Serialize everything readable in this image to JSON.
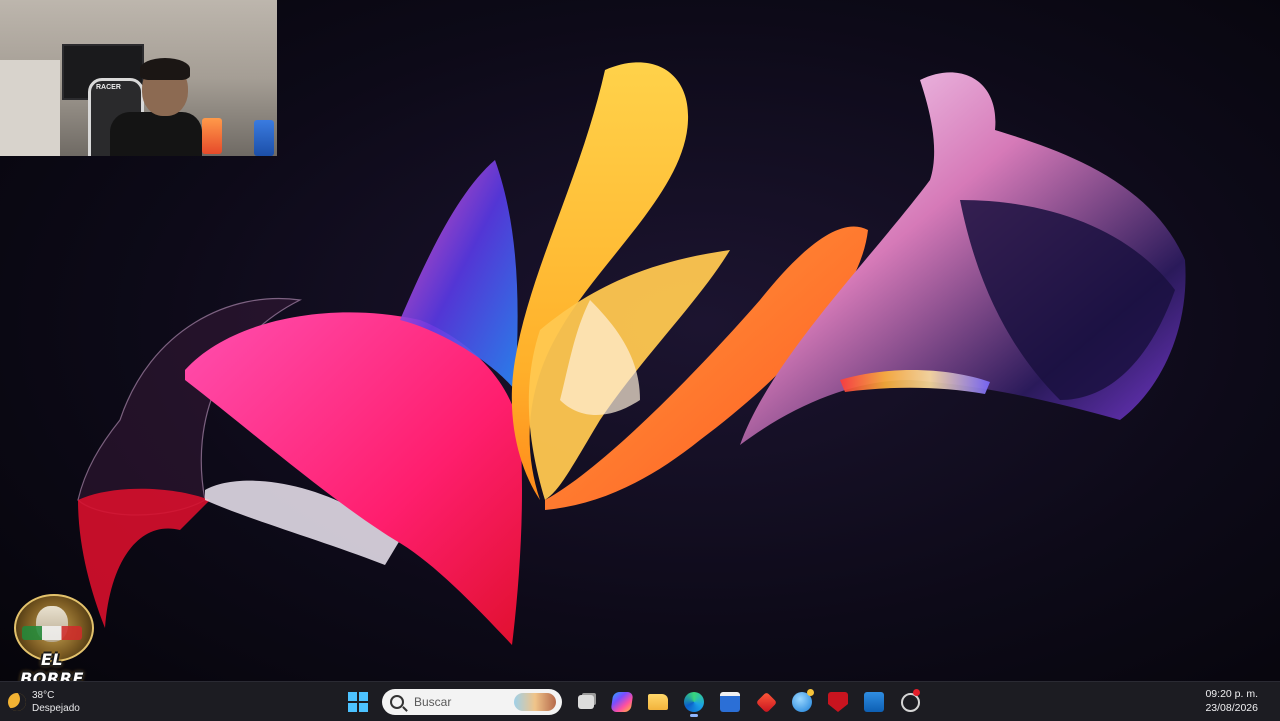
{
  "webcam": {
    "chair_brand": "RACER"
  },
  "logo_badge": {
    "text": "EL BORRE"
  },
  "taskbar": {
    "weather": {
      "temperature": "38°C",
      "condition": "Despejado",
      "icon": "moon-icon"
    },
    "search": {
      "placeholder": "Buscar"
    },
    "pinned_apps": [
      {
        "name": "start-button",
        "icon": "windows-logo-icon"
      },
      {
        "name": "task-view",
        "icon": "task-view-icon"
      },
      {
        "name": "copilot",
        "icon": "copilot-icon"
      },
      {
        "name": "file-explorer",
        "icon": "folder-icon"
      },
      {
        "name": "edge",
        "icon": "edge-icon",
        "active": true
      },
      {
        "name": "microsoft-store",
        "icon": "store-icon"
      },
      {
        "name": "app-red-diamond",
        "icon": "red-diamond-icon"
      },
      {
        "name": "app-globe",
        "icon": "globe-icon"
      },
      {
        "name": "mcafee",
        "icon": "shield-icon"
      },
      {
        "name": "outlook",
        "icon": "outlook-icon"
      },
      {
        "name": "clock-app",
        "icon": "clock-icon"
      }
    ],
    "clock": {
      "time": "09:20 p. m.",
      "date": "23/08/2026"
    }
  },
  "colors": {
    "taskbar_bg": "#1c1c22",
    "accent_windows": "#4cc2ff",
    "wallpaper_bg": "#0d0a18"
  }
}
